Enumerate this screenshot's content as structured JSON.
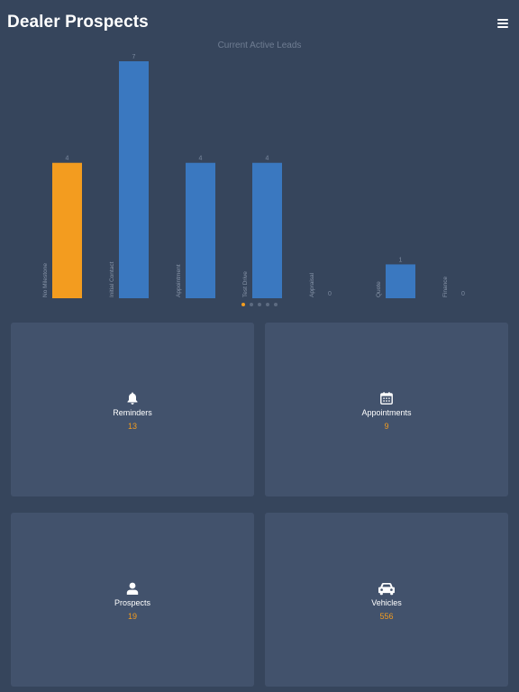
{
  "header": {
    "title": "Dealer Prospects"
  },
  "colors": {
    "background": "#36455c",
    "tile": "#42526c",
    "bar_highlight": "#f39c1f",
    "bar_default": "#3a78c0",
    "count_accent": "#f39c1f"
  },
  "chart_data": {
    "type": "bar",
    "title": "Current Active Leads",
    "categories": [
      "No Milestone",
      "Initial Contact",
      "Appointment",
      "Test Drive",
      "Appraisal",
      "Quote",
      "Finance"
    ],
    "values": [
      4,
      7,
      4,
      4,
      0,
      1,
      0
    ],
    "highlight_index": 0,
    "ylim": [
      0,
      7
    ],
    "grid": false,
    "legend": "none"
  },
  "pager": {
    "pages": 5,
    "active": 0
  },
  "tiles": [
    {
      "label": "Reminders",
      "count": "13",
      "icon": "bell-icon"
    },
    {
      "label": "Appointments",
      "count": "9",
      "icon": "calendar-icon"
    },
    {
      "label": "Prospects",
      "count": "19",
      "icon": "person-icon"
    },
    {
      "label": "Vehicles",
      "count": "556",
      "icon": "car-icon"
    }
  ]
}
